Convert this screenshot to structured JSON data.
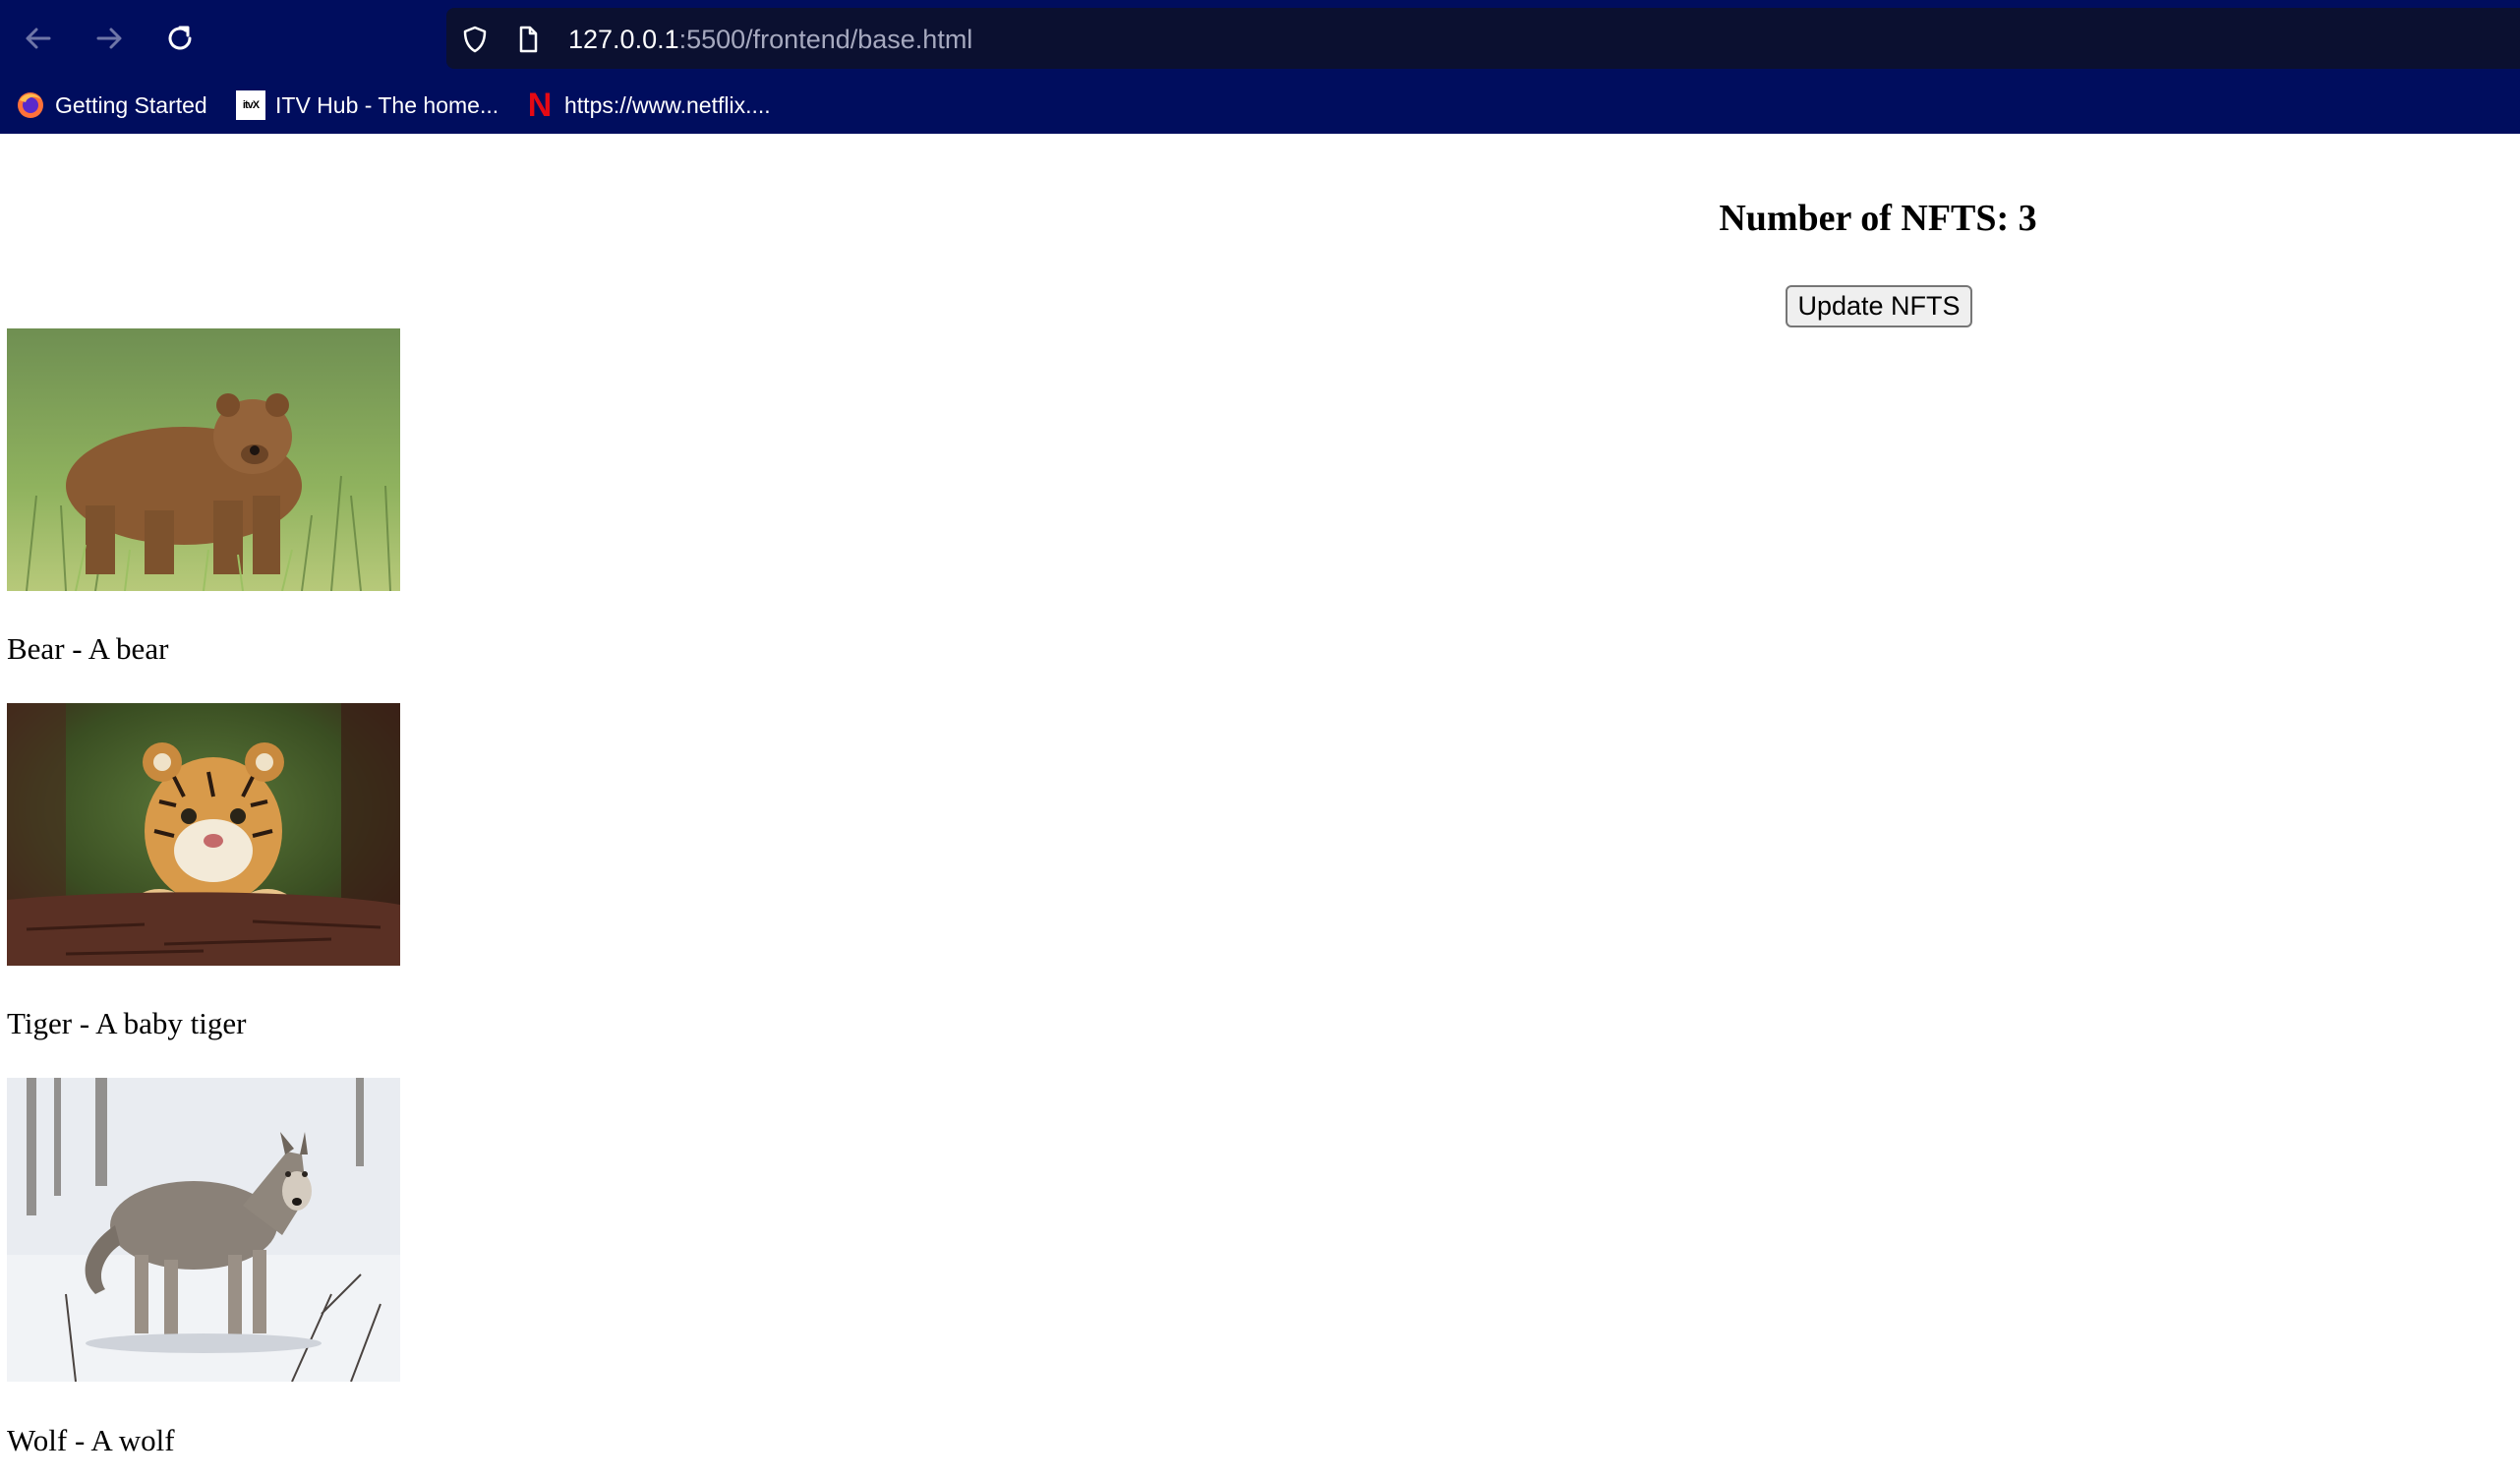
{
  "browser": {
    "url_host": "127.0.0.1",
    "url_rest": ":5500/frontend/base.html",
    "bookmarks": [
      {
        "label": "Getting Started",
        "icon": "firefox-icon"
      },
      {
        "label": "ITV Hub - The home...",
        "icon": "itv-logo-icon",
        "icon_text": "itvX"
      },
      {
        "label": "https://www.netflix....",
        "icon": "netflix-icon",
        "icon_text": "N"
      }
    ],
    "colors": {
      "chrome": "#000d5e",
      "urlbar": "#0b1030"
    }
  },
  "page": {
    "counter_title": "Number of NFTS: 3",
    "update_button": "Update NFTS",
    "nfts": [
      {
        "caption": "Bear - A bear",
        "image": "brown-bear-in-grass"
      },
      {
        "caption": "Tiger - A baby tiger",
        "image": "tiger-cub-on-log"
      },
      {
        "caption": "Wolf - A wolf",
        "image": "grey-wolf-in-snow"
      }
    ]
  }
}
